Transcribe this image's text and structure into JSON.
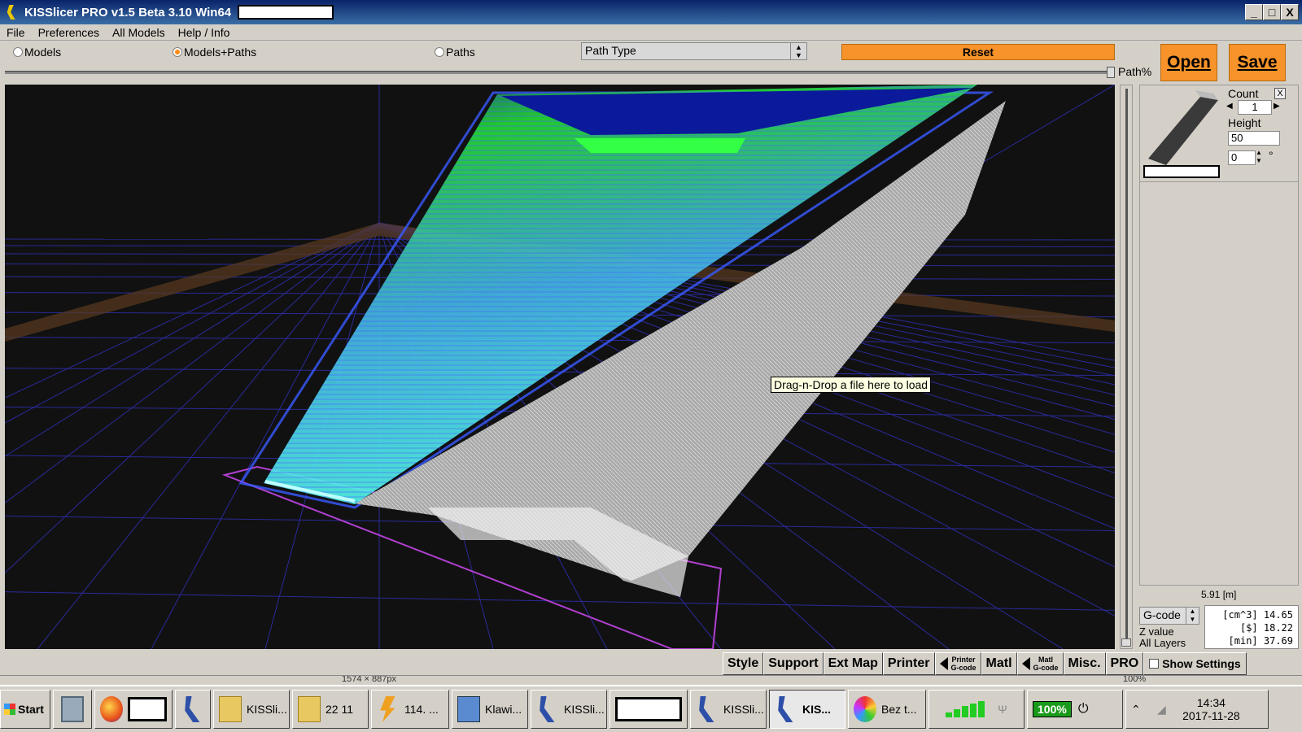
{
  "window": {
    "title": "KISSlicer PRO v1.5 Beta 3.10 Win64",
    "controls": [
      "_",
      "□",
      "X"
    ]
  },
  "menu": [
    "File",
    "Preferences",
    "All Models",
    "Help / Info"
  ],
  "view_modes": {
    "models": "Models",
    "models_paths": "Models+Paths",
    "paths": "Paths",
    "selected": "Models+Paths"
  },
  "path_type": "Path Type",
  "buttons": {
    "reset": "Reset",
    "open": "Open",
    "save": "Save"
  },
  "path_slider": {
    "label": "Path%",
    "value": 1.0
  },
  "viewport": {
    "tooltip": "Drag-n-Drop a file here to load"
  },
  "model_panel": {
    "close": "X",
    "count_label": "Count",
    "count": "1",
    "height_label": "Height",
    "height": "50",
    "rotation": "0",
    "degree_symbol": "°"
  },
  "summary": {
    "length": "5.91 [m]",
    "output_select": "G-code",
    "z_value_label": "Z value",
    "layers_label": "All Layers",
    "stats": [
      "[cm^3] 14.65",
      "[$] 18.22",
      "[min] 37.69"
    ]
  },
  "tabs": {
    "style": "Style",
    "support": "Support",
    "ext_map": "Ext Map",
    "printer": "Printer",
    "printer_gcode_1": "Printer",
    "printer_gcode_2": "G-code",
    "matl": "Matl",
    "matl_gcode_1": "Matl",
    "matl_gcode_2": "G-code",
    "misc": "Misc.",
    "pro": "PRO",
    "show_settings": "Show Settings"
  },
  "status_strip": {
    "dimensions": "1574 × 887px",
    "zoom": "100%"
  },
  "taskbar": {
    "start": "Start",
    "items": [
      {
        "label": "KISSli...",
        "icon": "folder-icon"
      },
      {
        "label": "22 11",
        "icon": "folder-icon"
      },
      {
        "label": "114. ...",
        "icon": "bolt-icon"
      },
      {
        "label": "Klawi...",
        "icon": "keyboard-icon"
      },
      {
        "label": "KISSli...",
        "icon": "kisslicer-icon"
      },
      {
        "label": "KISSli...",
        "icon": "kisslicer-icon"
      },
      {
        "label": "KIS...",
        "icon": "kisslicer-icon"
      },
      {
        "label": "Bez t...",
        "icon": "paint-icon"
      }
    ],
    "battery": "100%",
    "time": "14:34",
    "date": "2017-11-28"
  },
  "colors": {
    "accent_orange": "#f7932a",
    "title_blue": "#0a246a",
    "path_green": "#22dd33",
    "path_cyan": "#55ffee",
    "support_gray": "#b8b8b8",
    "grid_blue": "#2a2a9a"
  }
}
